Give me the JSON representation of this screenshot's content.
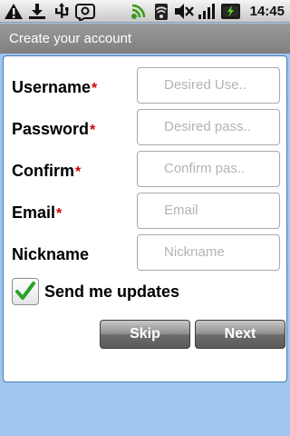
{
  "status_bar": {
    "time": "14:45",
    "icons": [
      "warning-icon",
      "download-icon",
      "usb-icon",
      "voicemail-icon",
      "signal-icon",
      "wifi-icon",
      "mute-icon",
      "cell-signal-icon",
      "battery-icon"
    ]
  },
  "title_bar": {
    "title": "Create your account"
  },
  "form": {
    "fields": [
      {
        "label": "Username",
        "required": "*",
        "placeholder": "Desired Use.."
      },
      {
        "label": "Password",
        "required": "*",
        "placeholder": "Desired pass.."
      },
      {
        "label": "Confirm",
        "required": "*",
        "placeholder": "Confirm pas.."
      },
      {
        "label": "Email",
        "required": "*",
        "placeholder": "Email"
      },
      {
        "label": "Nickname",
        "required": "",
        "placeholder": "Nickname"
      }
    ],
    "checkbox": {
      "label": "Send me updates",
      "checked": true
    }
  },
  "buttons": {
    "skip": "Skip",
    "next": "Next"
  },
  "colors": {
    "background": "#9fc6ef",
    "title_bar": "#8c8c8c",
    "required": "#d00000",
    "check": "#2aa22a",
    "button": "#7a7a7a"
  }
}
